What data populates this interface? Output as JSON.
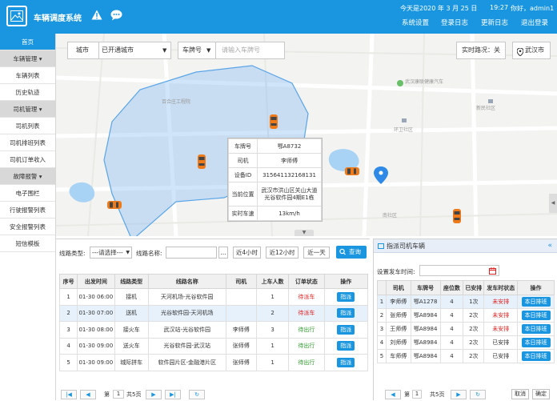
{
  "header": {
    "title": "车辆调度系统",
    "date_text": "今天是2020 年 3 月 25 日",
    "time": "19:27",
    "greeting": "你好，admin1",
    "nav": [
      "系统设置",
      "登录日志",
      "更新日志",
      "退出登录"
    ]
  },
  "sidebar": {
    "items": [
      {
        "label": "首页",
        "kind": "active"
      },
      {
        "label": "车辆管理 ▾",
        "kind": "group"
      },
      {
        "label": "车辆列表",
        "kind": "item"
      },
      {
        "label": "历史轨迹",
        "kind": "item"
      },
      {
        "label": "司机管理 ▾",
        "kind": "group"
      },
      {
        "label": "司机列表",
        "kind": "item"
      },
      {
        "label": "司机排班列表",
        "kind": "item"
      },
      {
        "label": "司机订单收入",
        "kind": "item"
      },
      {
        "label": "故障报警 ▾",
        "kind": "group"
      },
      {
        "label": "电子围栏",
        "kind": "item"
      },
      {
        "label": "行驶报警列表",
        "kind": "item"
      },
      {
        "label": "安全报警列表",
        "kind": "item"
      },
      {
        "label": "短信模板",
        "kind": "item"
      }
    ]
  },
  "map": {
    "city_label": "城市",
    "city_value": "已开通城市",
    "plate_label": "车牌号",
    "plate_placeholder": "请输入车牌号",
    "traffic_label": "实时路况：关",
    "location_label": "武汉市",
    "poi_labels": [
      "百合庄工程院",
      "武汉康联健康汽车",
      "新民社区",
      "环卫社区",
      "南社区"
    ],
    "popup": {
      "rows": [
        {
          "k": "车牌号",
          "v": "鄂A8732"
        },
        {
          "k": "司机",
          "v": "李师傅"
        },
        {
          "k": "设备ID",
          "v": "315641132168131"
        },
        {
          "k": "当前位置",
          "v": "武汉市洪山区关山大道光谷软件园4期E1栋"
        },
        {
          "k": "实时车速",
          "v": "13km/h"
        }
      ]
    }
  },
  "orders": {
    "filter": {
      "route_type_label": "线路类型:",
      "route_type_value": "---请选择---",
      "route_name_label": "线路名称:",
      "btn_4h": "近4小时",
      "btn_12h": "近12小时",
      "btn_1d": "近一天",
      "query_label": "查询"
    },
    "columns": [
      "序号",
      "出发时间",
      "线路类型",
      "线路名称",
      "司机",
      "上车人数",
      "订单状态",
      "操作"
    ],
    "rows": [
      {
        "no": "1",
        "time": "01-30 06:00",
        "type": "接机",
        "name": "天河机场-光谷软件园",
        "driver": "",
        "count": "1",
        "status": "待派车",
        "status_kind": "red",
        "action": "指派"
      },
      {
        "no": "2",
        "time": "01-30 07:00",
        "type": "送机",
        "name": "光谷软件园-天河机场",
        "driver": "",
        "count": "2",
        "status": "待派车",
        "status_kind": "red",
        "action": "指派"
      },
      {
        "no": "3",
        "time": "01-30 08:00",
        "type": "接火车",
        "name": "武汉站-光谷软件园",
        "driver": "李师傅",
        "count": "3",
        "status": "待出行",
        "status_kind": "green",
        "action": "指派"
      },
      {
        "no": "4",
        "time": "01-30 09:00",
        "type": "送火车",
        "name": "光谷软件园-武汉站",
        "driver": "张师傅",
        "count": "1",
        "status": "待出行",
        "status_kind": "green",
        "action": "指派"
      },
      {
        "no": "5",
        "time": "01-30 09:00",
        "type": "城际拼车",
        "name": "软件园片区-金融港片区",
        "driver": "张师傅",
        "count": "1",
        "status": "待出行",
        "status_kind": "green",
        "action": "指派"
      }
    ],
    "pager": {
      "page_label": "第",
      "page": "1",
      "total": "共5页"
    }
  },
  "dispatch": {
    "title": "指派司机车辆",
    "time_label": "设置发车时间:",
    "columns": [
      "",
      "司机",
      "车牌号",
      "座位数",
      "已安排",
      "发车时状态",
      "操作"
    ],
    "rows": [
      {
        "no": "1",
        "driver": "李师傅",
        "plate": "鄂A1278",
        "seats": "4",
        "arranged": "1次",
        "status": "未安排",
        "status_kind": "red",
        "action": "本日排班"
      },
      {
        "no": "2",
        "driver": "张师傅",
        "plate": "鄂A8984",
        "seats": "4",
        "arranged": "2次",
        "status": "未安排",
        "status_kind": "red",
        "action": "本日排班"
      },
      {
        "no": "3",
        "driver": "王师傅",
        "plate": "鄂A8984",
        "seats": "4",
        "arranged": "2次",
        "status": "未安排",
        "status_kind": "red",
        "action": "本日排班"
      },
      {
        "no": "4",
        "driver": "刘师傅",
        "plate": "鄂A8984",
        "seats": "4",
        "arranged": "2次",
        "status": "已安排",
        "status_kind": "normal",
        "action": "本日排班"
      },
      {
        "no": "5",
        "driver": "车师傅",
        "plate": "鄂A8984",
        "seats": "4",
        "arranged": "2次",
        "status": "已安排",
        "status_kind": "normal",
        "action": "本日排班"
      }
    ],
    "pager": {
      "page_label": "第",
      "page": "1",
      "total": "共5页"
    },
    "cancel_label": "取消",
    "confirm_label": "确定"
  },
  "colors": {
    "primary": "#1a96e0",
    "danger": "#e02020",
    "success": "#2a9a2a"
  }
}
